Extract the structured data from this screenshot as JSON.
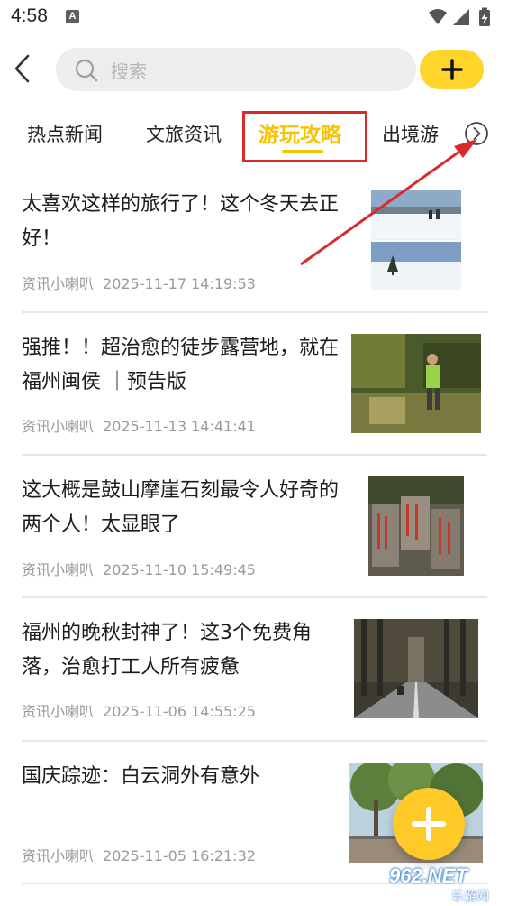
{
  "status_bar": {
    "time": "4:58",
    "notification_icon_letter": "A",
    "icons": [
      "wifi-icon",
      "signal-icon",
      "battery-charging-icon"
    ]
  },
  "header": {
    "search_placeholder": "搜索",
    "icons": [
      "back-arrow-icon",
      "search-icon",
      "plus-icon"
    ]
  },
  "tabs": {
    "items": [
      {
        "label": "热点新闻",
        "active": false
      },
      {
        "label": "文旅资讯",
        "active": false
      },
      {
        "label": "游玩攻略",
        "active": true
      },
      {
        "label": "出境游",
        "active": false
      }
    ],
    "more_icon": "chevron-right-circle-icon",
    "accent_color": "#f8c400",
    "annotation_color": "#d82a2a"
  },
  "articles": [
    {
      "title": "太喜欢这样的旅行了！这个冬天去正好！",
      "source": "资讯小喇叭",
      "time": "2025-11-17 14:19:53",
      "image": "snow-hiking-photo"
    },
    {
      "title": "强推！！超治愈的徒步露营地，就在福州闽侯 ｜预告版",
      "source": "资讯小喇叭",
      "time": "2025-11-13 14:41:41",
      "image": "forest-hiker-photo"
    },
    {
      "title": "这大概是鼓山摩崖石刻最令人好奇的两个人！太显眼了",
      "source": "资讯小喇叭",
      "time": "2025-11-10 15:49:45",
      "image": "rock-carving-photo"
    },
    {
      "title": "福州的晚秋封神了！这3个免费角落，治愈打工人所有疲惫",
      "source": "资讯小喇叭",
      "time": "2025-11-06 14:55:25",
      "image": "tree-lined-road-photo"
    },
    {
      "title": "国庆踪迹：白云洞外有意外",
      "source": "资讯小喇叭",
      "time": "2025-11-05 16:21:32",
      "image": "park-trees-photo"
    }
  ],
  "fab": {
    "icon": "plus-icon",
    "color": "#ffc928"
  },
  "watermark": {
    "text": "962.NET",
    "sub": "乐游网"
  }
}
